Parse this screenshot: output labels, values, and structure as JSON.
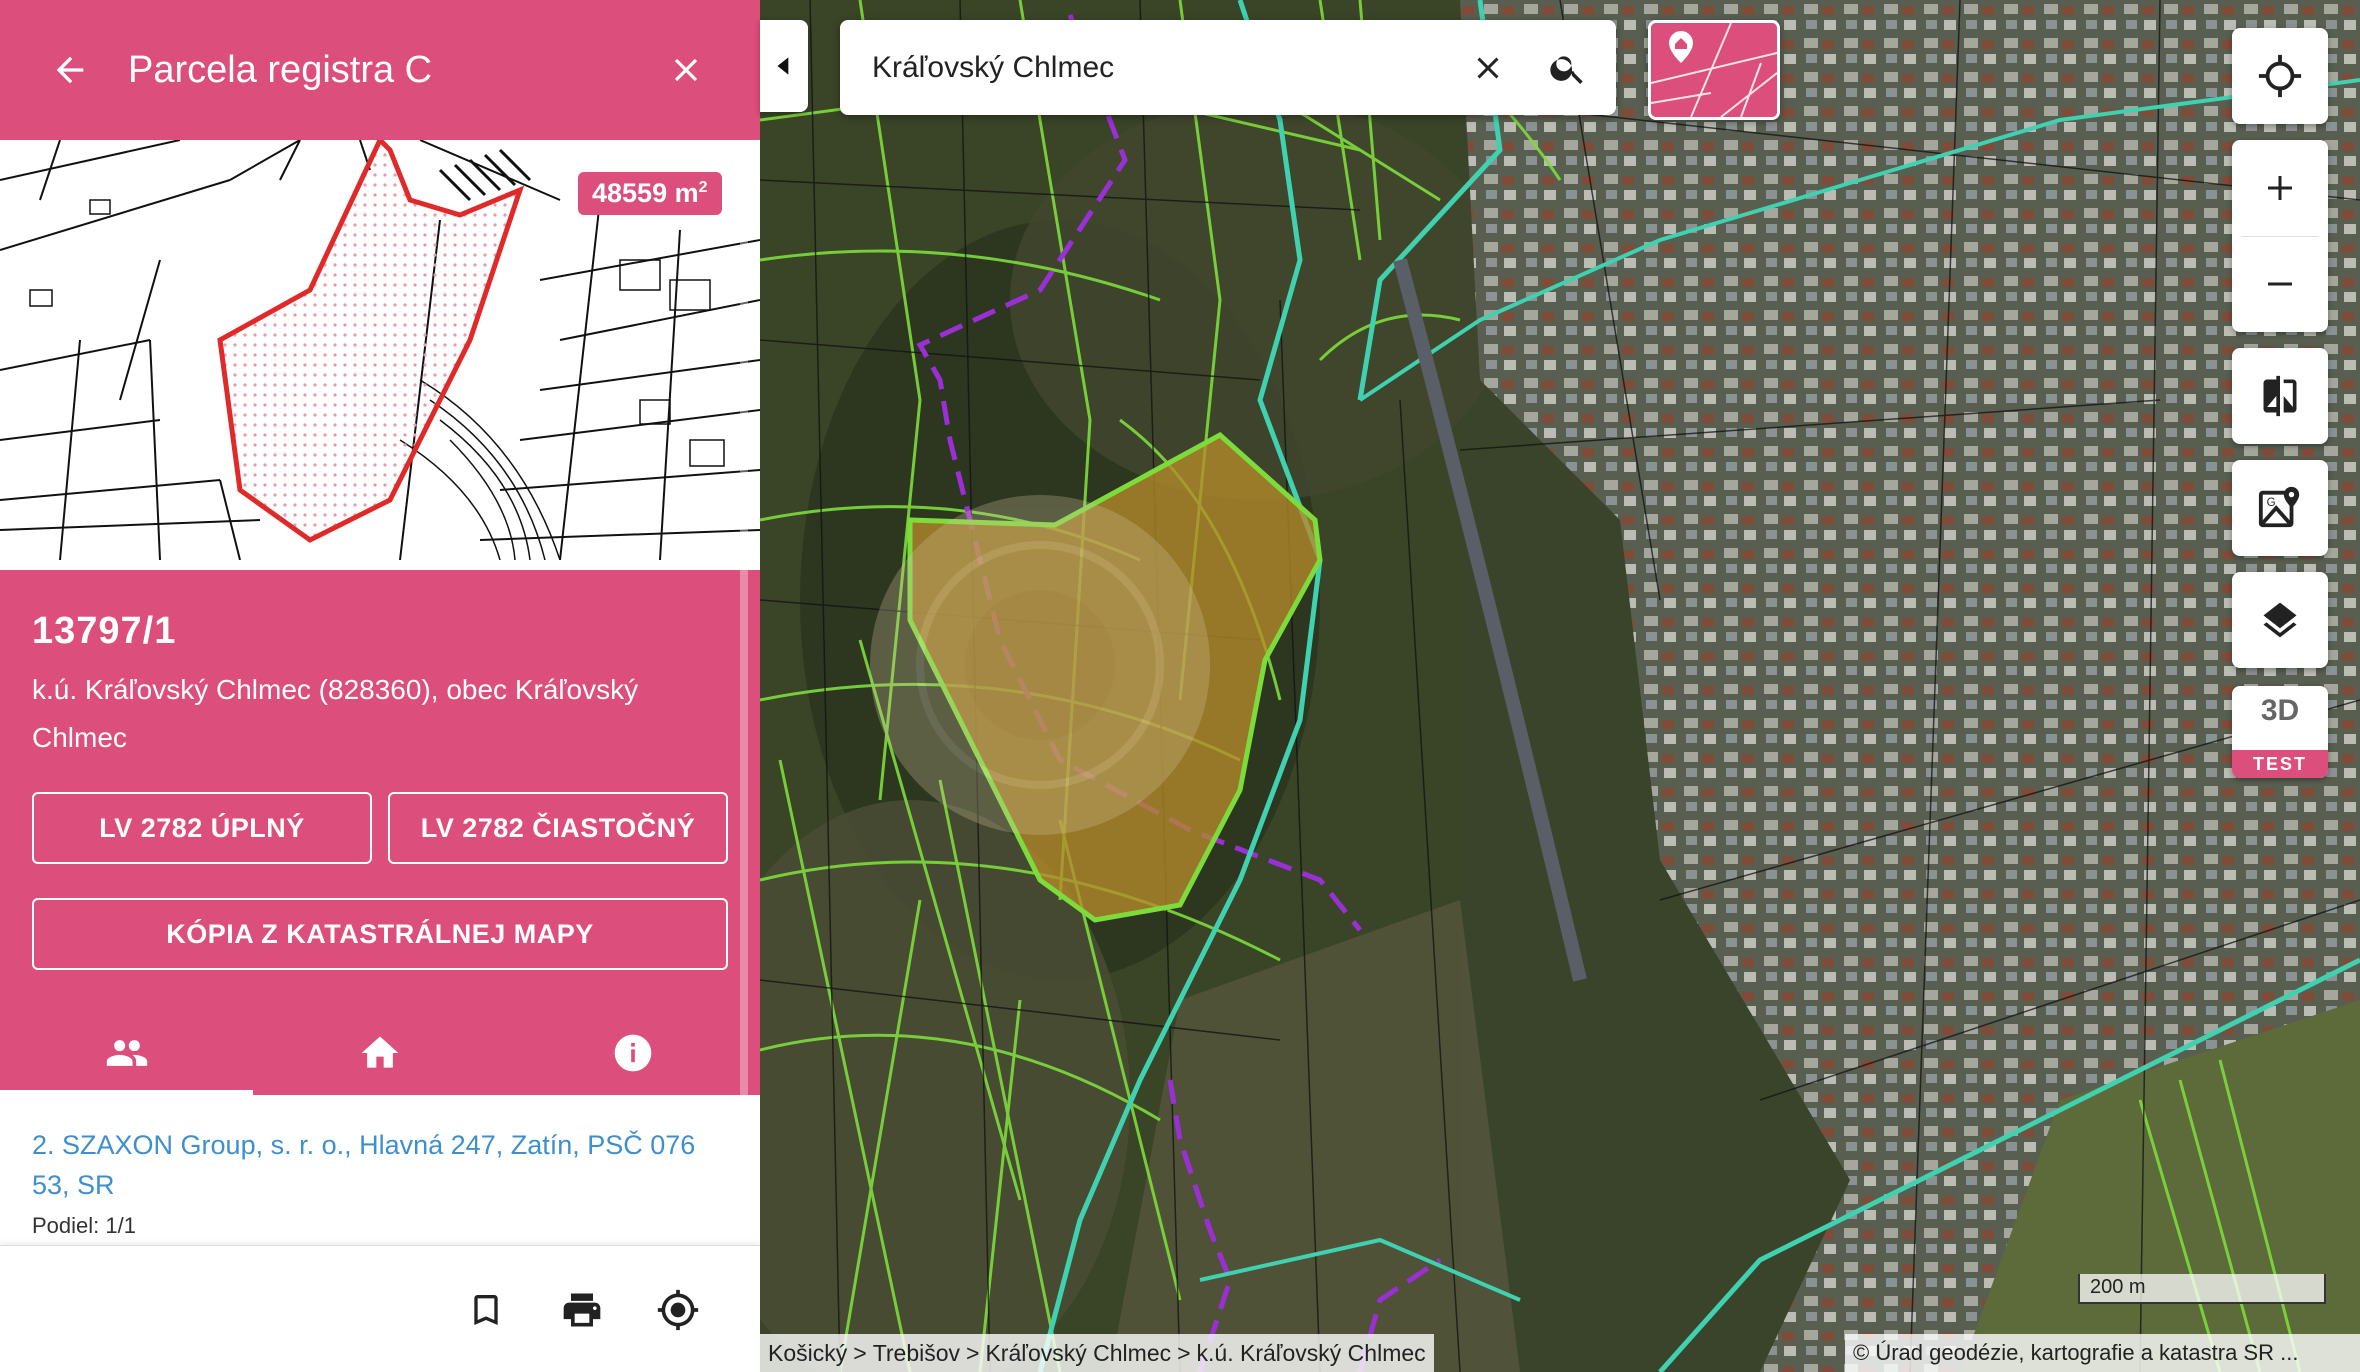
{
  "panel": {
    "title": "Parcela registra C",
    "area_value": "48559 m",
    "area_unit_sup": "2",
    "parcel_number": "13797/1",
    "address": "k.ú. Kráľovský Chlmec (828360), obec Kráľovský Chlmec",
    "buttons": {
      "lv_full": "LV 2782 ÚPLNÝ",
      "lv_partial": "LV 2782 ČIASTOČNÝ",
      "map_copy": "KÓPIA Z KATASTRÁLNEJ MAPY"
    },
    "tabs": [
      {
        "name": "owners",
        "icon": "people-icon",
        "active": true
      },
      {
        "name": "building",
        "icon": "home-icon",
        "active": false
      },
      {
        "name": "info",
        "icon": "info-icon",
        "active": false
      }
    ],
    "owner": {
      "text": "2. SZAXON Group, s. r. o., Hlavná 247, Zatín, PSČ 076 53, SR",
      "share": "Podiel: 1/1"
    },
    "footer_icons": [
      "bookmark-icon",
      "print-icon",
      "locate-icon"
    ]
  },
  "search": {
    "value": "Kráľovský Chlmec",
    "placeholder": ""
  },
  "map": {
    "scale_label": "200 m",
    "breadcrumb": [
      "Košický",
      "Trebišov",
      "Kráľovský Chlmec",
      "k.ú. Kráľovský Chlmec"
    ],
    "breadcrumb_sep": ">",
    "copyright": "© Úrad geodézie, kartografie a katastra SR ...",
    "controls": [
      "my-location-icon",
      "zoom-in-icon",
      "zoom-out-icon",
      "compare-icon",
      "street-view-icon",
      "layers-icon"
    ],
    "btn_3d": "3D",
    "btn_test": "TEST"
  },
  "colors": {
    "accent": "#dc4e7c",
    "parcel_line": "#7ddc3c",
    "highlight_fill": "#b38a2a",
    "boundary_purple": "#9b2fd6",
    "boundary_teal": "#3fd1b0",
    "link": "#3d8fcf"
  }
}
